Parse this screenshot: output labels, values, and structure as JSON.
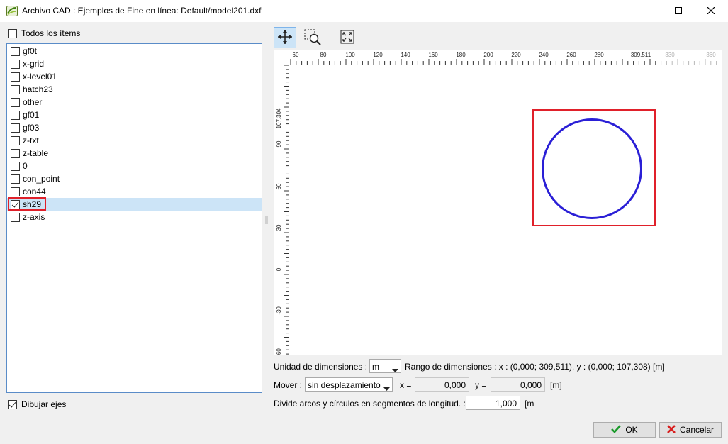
{
  "window": {
    "title": "Archivo CAD : Ejemplos de Fine en línea: Default/model201.dxf",
    "icons": [
      "app-icon",
      "minimize-icon",
      "maximize-icon",
      "close-icon"
    ]
  },
  "left_panel": {
    "all_items_label": "Todos los ítems",
    "all_items_checked": false,
    "layers": [
      {
        "label": "gf0t",
        "checked": false
      },
      {
        "label": "x-grid",
        "checked": false
      },
      {
        "label": "x-level01",
        "checked": false
      },
      {
        "label": "hatch23",
        "checked": false
      },
      {
        "label": "other",
        "checked": false
      },
      {
        "label": "gf01",
        "checked": false
      },
      {
        "label": "gf03",
        "checked": false
      },
      {
        "label": "z-txt",
        "checked": false
      },
      {
        "label": "z-table",
        "checked": false
      },
      {
        "label": "0",
        "checked": false
      },
      {
        "label": "con_point",
        "checked": false
      },
      {
        "label": "con44",
        "checked": false
      },
      {
        "label": "sh29",
        "checked": true,
        "selected": true,
        "highlighted": true
      },
      {
        "label": "z-axis",
        "checked": false
      }
    ],
    "draw_axes_label": "Dibujar ejes",
    "draw_axes_checked": true
  },
  "toolbar": {
    "tools": [
      "move-tool",
      "zoom-window-tool",
      "zoom-extents-tool"
    ],
    "active": "move-tool"
  },
  "drawing": {
    "x_ticks": [
      "60",
      "80",
      "100",
      "120",
      "140",
      "160",
      "180",
      "200",
      "220",
      "240",
      "260",
      "280",
      "309,511",
      "330",
      "360"
    ],
    "y_ticks": [
      "107,304",
      "90",
      "60",
      "30",
      "0",
      "-30",
      "-60"
    ],
    "circle_color": "#2a1fd6",
    "highlight_color": "#e0202a"
  },
  "settings": {
    "units_label": "Unidad de dimensiones :",
    "units_value": "m",
    "range_text": "Rango de dimensiones : x : (0,000; 309,511), y : (0,000; 107,308) [m]",
    "move_label": "Mover :",
    "move_value": "sin desplazamiento",
    "x_label": "x =",
    "x_value": "0,000",
    "y_label": "y =",
    "y_value": "0,000",
    "move_unit": "[m]",
    "segment_label": "Divide arcos y círculos en segmentos de longitud. :",
    "segment_value": "1,000",
    "segment_unit": "[m"
  },
  "footer": {
    "ok_label": "OK",
    "cancel_label": "Cancelar",
    "ok_color": "#1a9a2a",
    "cancel_color": "#d81e1e"
  }
}
